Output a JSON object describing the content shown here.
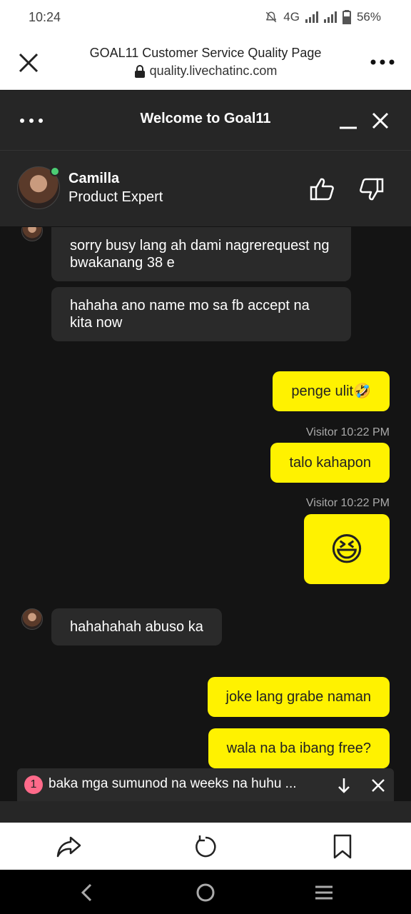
{
  "status": {
    "time": "10:24",
    "network": "4G",
    "battery": "56%"
  },
  "browser": {
    "page_title": "GOAL11 Customer Service Quality Page",
    "url": "quality.livechatinc.com",
    "close_icon": "close-icon",
    "menu_icon": "more-vertical-icon"
  },
  "chat_header": {
    "title": "Welcome to Goal11"
  },
  "agent": {
    "name": "Camilla",
    "role": "Product Expert"
  },
  "messages": [
    {
      "from": "agent",
      "text": "sorry busy lang ah dami nagrerequest ng bwakanang 38 e"
    },
    {
      "from": "agent",
      "text": "hahaha ano name mo sa fb accept na kita now"
    },
    {
      "from": "visitor",
      "text": "penge ulit🤣"
    },
    {
      "meta": "Visitor 10:22 PM"
    },
    {
      "from": "visitor",
      "text": "talo kahapon"
    },
    {
      "meta": "Visitor 10:22 PM"
    },
    {
      "from": "visitor",
      "text": "😆"
    },
    {
      "from": "agent",
      "text": "hahahahah abuso ka"
    },
    {
      "from": "visitor",
      "text": "joke lang grabe naman"
    },
    {
      "from": "visitor",
      "text": "wala na ba ibang free?"
    }
  ],
  "notification": {
    "count": "1",
    "text": "baka mga sumunod na weeks na huhu ..."
  },
  "colors": {
    "visitor_bubble": "#fff200",
    "agent_bubble": "#2a2a2a",
    "chat_bg": "#141414",
    "online": "#4ccd74",
    "badge": "#ff6a8a"
  }
}
